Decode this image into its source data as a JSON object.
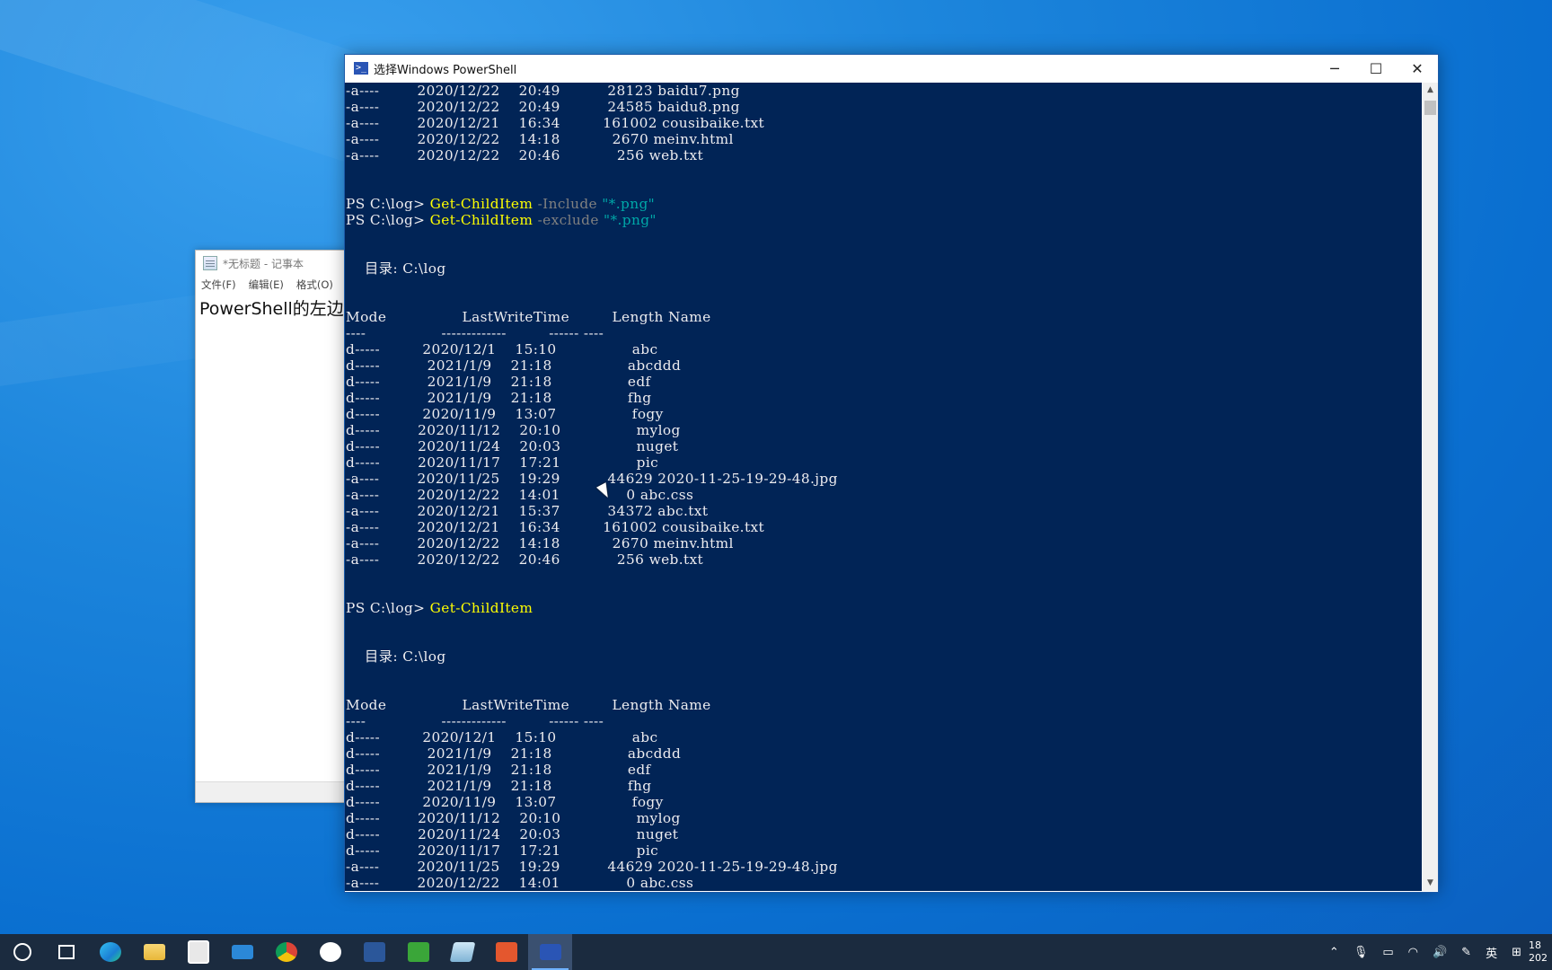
{
  "notepad": {
    "title": "*无标题 - 记事本",
    "menu": [
      "文件(F)",
      "编辑(E)",
      "格式(O)"
    ],
    "content": "PowerShell的左边"
  },
  "powershell": {
    "title": "选择Windows PowerShell",
    "controls": {
      "minimize": "─",
      "maximize": "☐",
      "close": "✕"
    }
  },
  "console_top_rows": [
    [
      "-a----",
      "2020/12/22",
      "20:49",
      "28123",
      "baidu7.png"
    ],
    [
      "-a----",
      "2020/12/22",
      "20:49",
      "24585",
      "baidu8.png"
    ],
    [
      "-a----",
      "2020/12/21",
      "16:34",
      "161002",
      "cousibaike.txt"
    ],
    [
      "-a----",
      "2020/12/22",
      "14:18",
      "2670",
      "meinv.html"
    ],
    [
      "-a----",
      "2020/12/22",
      "20:46",
      "256",
      "web.txt"
    ]
  ],
  "commands": [
    {
      "prompt": "PS C:\\log> ",
      "cmd": "Get-ChildItem",
      "param": "-Include",
      "arg": "\"*.png\""
    },
    {
      "prompt": "PS C:\\log> ",
      "cmd": "Get-ChildItem",
      "param": "-exclude",
      "arg": "\"*.png\""
    },
    {
      "prompt": "PS C:\\log> ",
      "cmd": "Get-ChildItem",
      "param": "",
      "arg": ""
    }
  ],
  "directory_label": "    目录: C:\\log",
  "headers": {
    "mode": "Mode",
    "lastwrite": "LastWriteTime",
    "length": "Length",
    "name": "Name"
  },
  "listing1": [
    [
      "d-----",
      "2020/12/1",
      "15:10",
      "",
      "abc"
    ],
    [
      "d-----",
      "2021/1/9",
      "21:18",
      "",
      "abcddd"
    ],
    [
      "d-----",
      "2021/1/9",
      "21:18",
      "",
      "edf"
    ],
    [
      "d-----",
      "2021/1/9",
      "21:18",
      "",
      "fhg"
    ],
    [
      "d-----",
      "2020/11/9",
      "13:07",
      "",
      "fogy"
    ],
    [
      "d-----",
      "2020/11/12",
      "20:10",
      "",
      "mylog"
    ],
    [
      "d-----",
      "2020/11/24",
      "20:03",
      "",
      "nuget"
    ],
    [
      "d-----",
      "2020/11/17",
      "17:21",
      "",
      "pic"
    ],
    [
      "-a----",
      "2020/11/25",
      "19:29",
      "44629",
      "2020-11-25-19-29-48.jpg"
    ],
    [
      "-a----",
      "2020/12/22",
      "14:01",
      "0",
      "abc.css"
    ],
    [
      "-a----",
      "2020/12/21",
      "15:37",
      "34372",
      "abc.txt"
    ],
    [
      "-a----",
      "2020/12/21",
      "16:34",
      "161002",
      "cousibaike.txt"
    ],
    [
      "-a----",
      "2020/12/22",
      "14:18",
      "2670",
      "meinv.html"
    ],
    [
      "-a----",
      "2020/12/22",
      "20:46",
      "256",
      "web.txt"
    ]
  ],
  "listing2": [
    [
      "d-----",
      "2020/12/1",
      "15:10",
      "",
      "abc"
    ],
    [
      "d-----",
      "2021/1/9",
      "21:18",
      "",
      "abcddd"
    ],
    [
      "d-----",
      "2021/1/9",
      "21:18",
      "",
      "edf"
    ],
    [
      "d-----",
      "2021/1/9",
      "21:18",
      "",
      "fhg"
    ],
    [
      "d-----",
      "2020/11/9",
      "13:07",
      "",
      "fogy"
    ],
    [
      "d-----",
      "2020/11/12",
      "20:10",
      "",
      "mylog"
    ],
    [
      "d-----",
      "2020/11/24",
      "20:03",
      "",
      "nuget"
    ],
    [
      "d-----",
      "2020/11/17",
      "17:21",
      "",
      "pic"
    ],
    [
      "-a----",
      "2020/11/25",
      "19:29",
      "44629",
      "2020-11-25-19-29-48.jpg"
    ],
    [
      "-a----",
      "2020/12/22",
      "14:01",
      "0",
      "abc.css"
    ]
  ],
  "taskbar": {
    "apps": [
      "start-icon",
      "task-view-icon",
      "edge-icon",
      "file-explorer-icon",
      "store-icon",
      "mail-icon",
      "chrome-icon",
      "feather-icon",
      "word-icon",
      "camtasia-icon",
      "notepad-icon",
      "screen-recorder-icon",
      "powershell-icon"
    ],
    "ime": "英",
    "clock": [
      "18",
      "202"
    ]
  }
}
